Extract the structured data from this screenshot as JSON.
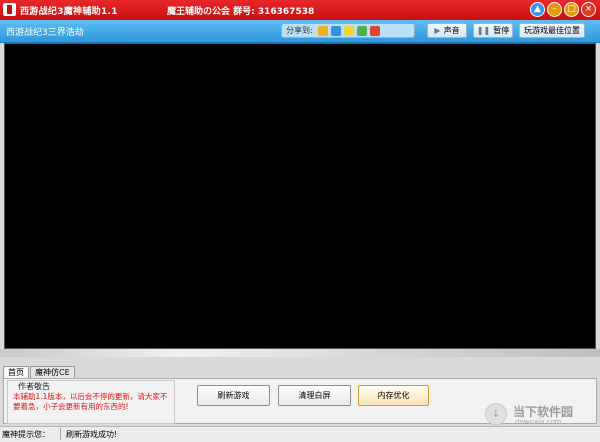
{
  "window": {
    "title": "西游战纪3魔神辅助1.1",
    "guild_text": "魔王辅助の公会  群号: 316367538",
    "controls": {
      "skin": "shirt-icon",
      "minimize": "minimize-icon",
      "maximize": "maximize-icon",
      "close": "close-icon"
    }
  },
  "toolbar": {
    "game_title": "西游战纪3三界浩劫",
    "share_label": "分享到:",
    "share_icons": [
      "qzone-icon",
      "tencent-weibo-icon",
      "renren-icon",
      "kaixin-icon",
      "sina-weibo-icon"
    ],
    "sound_label": "声音",
    "pause_label": "暂停",
    "best_position_label": "玩游戏最佳位置"
  },
  "tabs": [
    "首页",
    "魔神仿CE"
  ],
  "panel": {
    "group_label": "作者敬告",
    "notice": "本辅助1.1版本，以后会不停的更新，请大家不要着急，小子会更新有用的东西的!",
    "buttons": [
      "刷新游戏",
      "清理白屏",
      "内存优化"
    ]
  },
  "status": {
    "label": "魔神提示您：",
    "message": "刷新游戏成功!"
  },
  "watermark": {
    "text": "当下软件园",
    "sub": "downxia.com"
  },
  "colors": {
    "titlebar": "#d41a1b",
    "toolbar": "#3ea6e6",
    "notice": "#e21515"
  }
}
